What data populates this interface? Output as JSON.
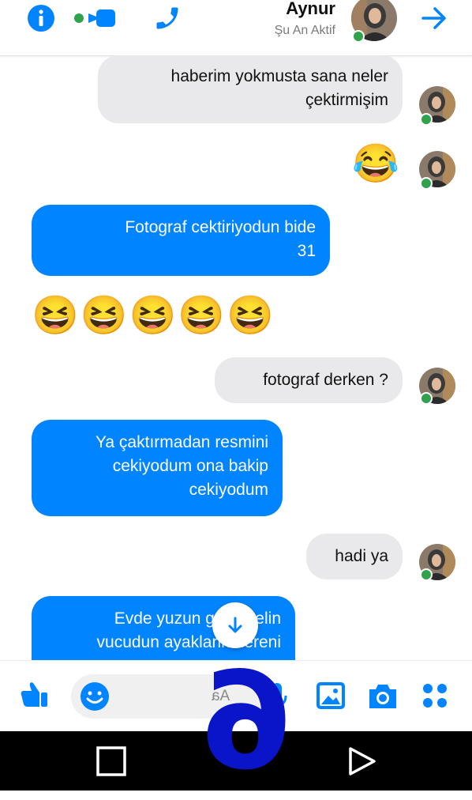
{
  "header": {
    "contact_name": "Aynur",
    "status": "Şu An Aktif",
    "icons": [
      "back-arrow-icon",
      "phone-icon",
      "video-icon",
      "info-icon"
    ]
  },
  "messages": [
    {
      "side": "in",
      "text_lines": [
        "haberim yokmusta sana neler",
        "çektirmişim"
      ]
    },
    {
      "side": "in",
      "emoji": "😂"
    },
    {
      "side": "out",
      "text_lines": [
        "Fotograf cektiriyodun bide",
        "31"
      ]
    },
    {
      "side": "out",
      "emoji": "😆😆😆😆😆"
    },
    {
      "side": "in",
      "text_lines": [
        "fotograf derken ?"
      ]
    },
    {
      "side": "out",
      "text_lines": [
        "Ya çaktırmadan resmini",
        "cekiyodum ona bakip",
        "cekiyodum"
      ]
    },
    {
      "side": "in",
      "text_lines": [
        "hadi ya"
      ]
    },
    {
      "side": "out",
      "text_lines": [
        "Evde yuzun gozun elin",
        "vucudun ayaklarin nereni"
      ]
    }
  ],
  "composer": {
    "placeholder": "Aa",
    "icons": [
      "like-icon",
      "emoji-icon",
      "microphone-icon",
      "gallery-icon",
      "camera-icon",
      "apps-icon"
    ]
  },
  "overlay_number": "6",
  "colors": {
    "accent": "#0084ff",
    "online": "#31a24c",
    "overlay": "#0a14c8"
  }
}
